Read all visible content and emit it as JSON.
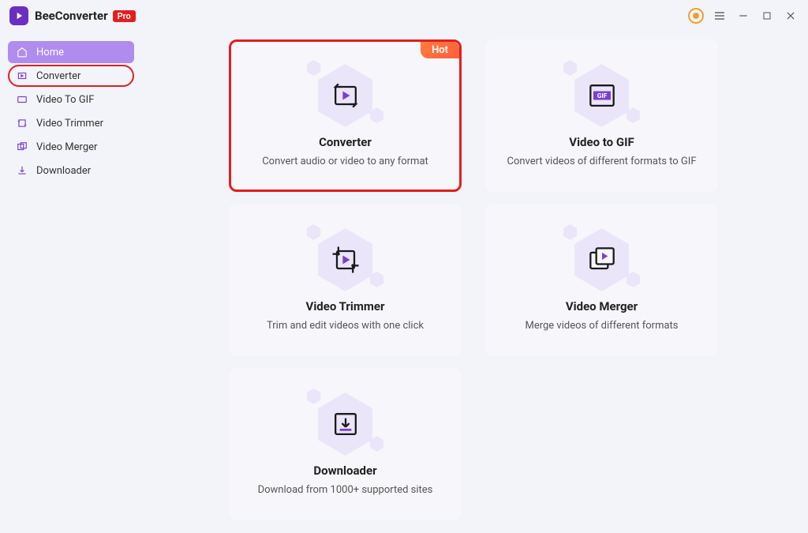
{
  "app": {
    "name": "BeeConverter",
    "badge": "Pro"
  },
  "sidebar": {
    "items": [
      {
        "label": "Home",
        "icon": "home"
      },
      {
        "label": "Converter",
        "icon": "converter"
      },
      {
        "label": "Video To GIF",
        "icon": "gif"
      },
      {
        "label": "Video Trimmer",
        "icon": "trimmer"
      },
      {
        "label": "Video Merger",
        "icon": "merger"
      },
      {
        "label": "Downloader",
        "icon": "download"
      }
    ]
  },
  "cards": [
    {
      "title": "Converter",
      "desc": "Convert audio or video to any format",
      "badge": "Hot"
    },
    {
      "title": "Video to GIF",
      "desc": "Convert videos of different formats to GIF"
    },
    {
      "title": "Video Trimmer",
      "desc": "Trim and edit videos with one click"
    },
    {
      "title": "Video Merger",
      "desc": "Merge videos of different formats"
    },
    {
      "title": "Downloader",
      "desc": "Download from 1000+ supported sites"
    }
  ]
}
